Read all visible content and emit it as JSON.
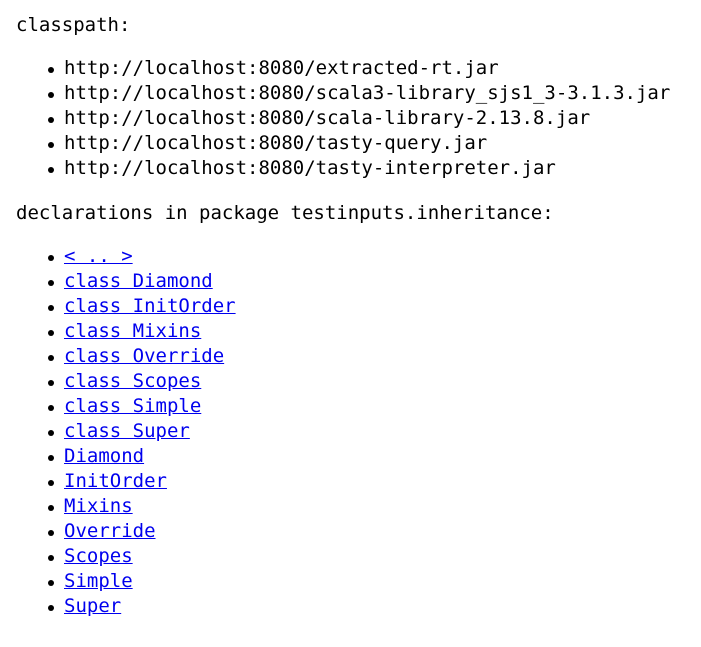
{
  "classpath": {
    "heading": "classpath:",
    "items": [
      "http://localhost:8080/extracted-rt.jar",
      "http://localhost:8080/scala3-library_sjs1_3-3.1.3.jar",
      "http://localhost:8080/scala-library-2.13.8.jar",
      "http://localhost:8080/tasty-query.jar",
      "http://localhost:8080/tasty-interpreter.jar"
    ]
  },
  "declarations": {
    "heading": "declarations in package testinputs.inheritance:",
    "links": [
      "< .. >",
      "class Diamond",
      "class InitOrder",
      "class Mixins",
      "class Override",
      "class Scopes",
      "class Simple",
      "class Super",
      "Diamond",
      "InitOrder",
      "Mixins",
      "Override",
      "Scopes",
      "Simple",
      "Super"
    ]
  }
}
